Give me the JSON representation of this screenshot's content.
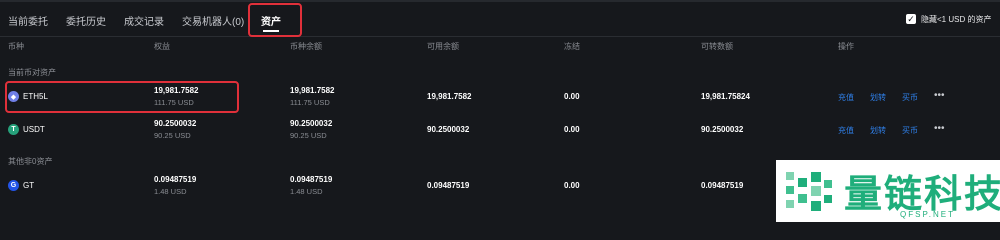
{
  "tabs": [
    {
      "label": "当前委托"
    },
    {
      "label": "委托历史"
    },
    {
      "label": "成交记录"
    },
    {
      "label": "交易机器人(0)"
    },
    {
      "label": "资产"
    }
  ],
  "hide_small": {
    "label": "隐藏<1 USD 的资产",
    "checked": true
  },
  "columns": [
    "币种",
    "权益",
    "币种余额",
    "可用余额",
    "冻结",
    "可转数额",
    "操作"
  ],
  "sections": {
    "current": "当前币对资产",
    "other": "其他非0资产"
  },
  "rows": [
    {
      "coin": "ETH5L",
      "icon": "ethereum-icon",
      "icon_color": "#6f7fe6",
      "equity": "19,981.7582",
      "equity_usd": "111.75 USD",
      "balance": "19,981.7582",
      "balance_usd": "111.75 USD",
      "available": "19,981.7582",
      "frozen": "0.00",
      "transferable": "19,981.75824"
    },
    {
      "coin": "USDT",
      "icon": "tether-icon",
      "icon_color": "#26a17b",
      "equity": "90.2500032",
      "equity_usd": "90.25 USD",
      "balance": "90.2500032",
      "balance_usd": "90.25 USD",
      "available": "90.2500032",
      "frozen": "0.00",
      "transferable": "90.2500032"
    },
    {
      "coin": "GT",
      "icon": "gatetoken-icon",
      "icon_color": "#2354e6",
      "equity": "0.09487519",
      "equity_usd": "1.48 USD",
      "balance": "0.09487519",
      "balance_usd": "1.48 USD",
      "available": "0.09487519",
      "frozen": "0.00",
      "transferable": "0.09487519"
    }
  ],
  "actions": {
    "deposit": "充值",
    "transfer": "划转",
    "buy": "买币",
    "more": "•••"
  },
  "watermark": {
    "text": "量链科技",
    "url": "QFSP.NET"
  },
  "colors": {
    "background": "#16181c",
    "link": "#2f7fe8",
    "highlight": "#e0303a",
    "watermark": "#1fae7b"
  }
}
